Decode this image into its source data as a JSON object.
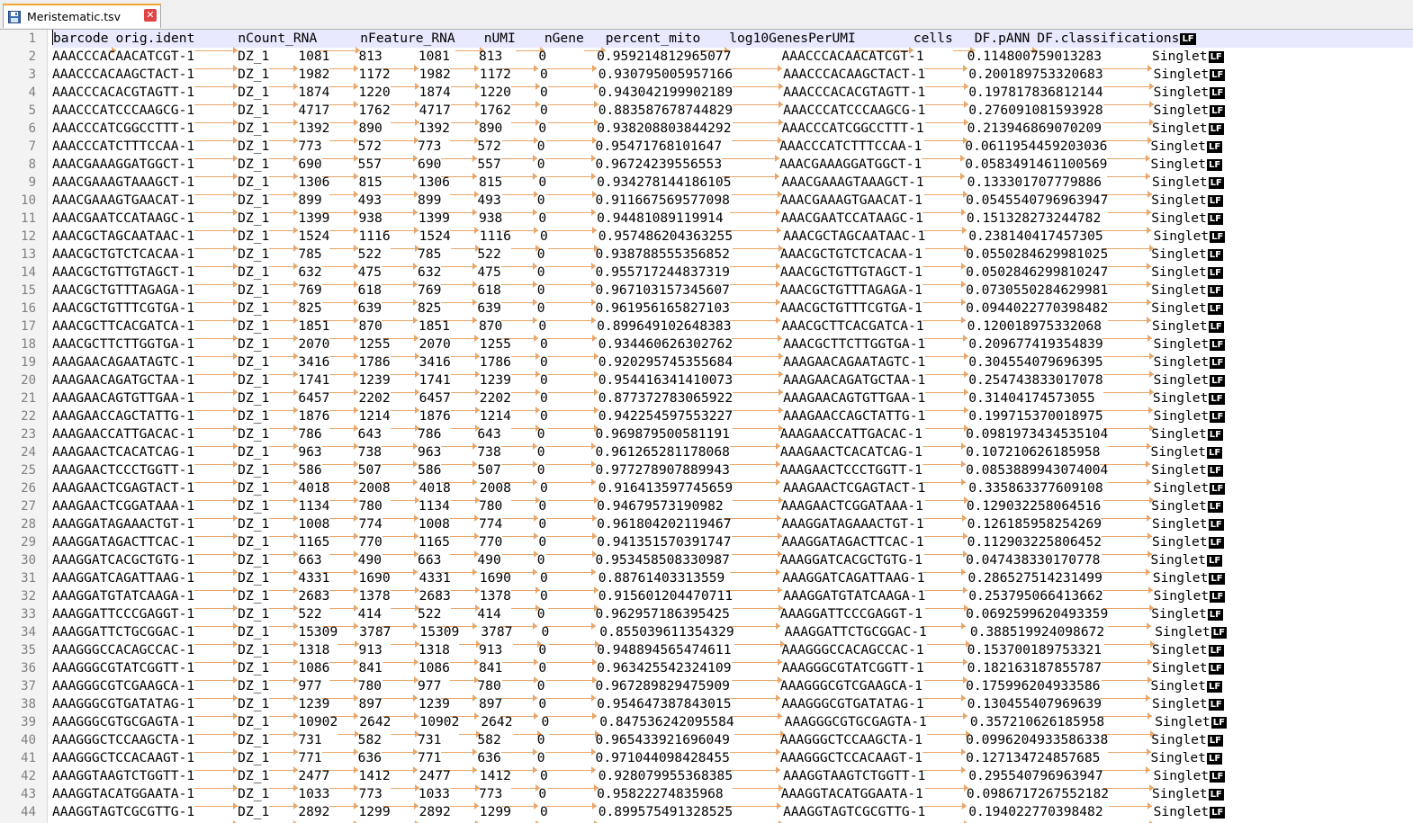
{
  "tab": {
    "title": "Meristematic.tsv",
    "icon": "save-file-icon",
    "close_icon": "close-icon",
    "accent": "#f2a431"
  },
  "editor": {
    "tab_glyph": "→",
    "eol_label": "LF",
    "lines": [
      [
        "barcode",
        "orig.ident",
        "nCount_RNA",
        "nFeature_RNA",
        "nUMI",
        "nGene",
        "percent_mito",
        "log10GenesPerUMI",
        "cells",
        "DF.pANN",
        "DF.classifications"
      ],
      [
        "AAACCCACAACATCGT-1",
        "DZ_1",
        "1081",
        "813",
        "1081",
        "813",
        "0",
        "0.959214812965077",
        "AAACCCACAACATCGT-1",
        "0.114800759013283",
        "Singlet"
      ],
      [
        "AAACCCACAAGCTACT-1",
        "DZ_1",
        "1982",
        "1172",
        "1982",
        "1172",
        "0",
        "0.930795005957166",
        "AAACCCACAAGCTACT-1",
        "0.200189753320683",
        "Singlet"
      ],
      [
        "AAACCCACACGTAGTT-1",
        "DZ_1",
        "1874",
        "1220",
        "1874",
        "1220",
        "0",
        "0.943042199902189",
        "AAACCCACACGTAGTT-1",
        "0.197817836812144",
        "Singlet"
      ],
      [
        "AAACCCATCCCAAGCG-1",
        "DZ_1",
        "4717",
        "1762",
        "4717",
        "1762",
        "0",
        "0.883587678744829",
        "AAACCCATCCCAAGCG-1",
        "0.276091081593928",
        "Singlet"
      ],
      [
        "AAACCCATCGGCCTTT-1",
        "DZ_1",
        "1392",
        "890",
        "1392",
        "890",
        "0",
        "0.938208803844292",
        "AAACCCATCGGCCTTT-1",
        "0.213946869070209",
        "Singlet"
      ],
      [
        "AAACCCATCTTTCCAA-1",
        "DZ_1",
        "773",
        "572",
        "773",
        "572",
        "0",
        "0.95471768101647",
        "AAACCCATCTTTCCAA-1",
        "0.0611954459203036",
        "Singlet"
      ],
      [
        "AAACGAAAGGATGGCT-1",
        "DZ_1",
        "690",
        "557",
        "690",
        "557",
        "0",
        "0.96724239556553",
        "AAACGAAAGGATGGCT-1",
        "0.0583491461100569",
        "Singlet"
      ],
      [
        "AAACGAAAGTAAAGCT-1",
        "DZ_1",
        "1306",
        "815",
        "1306",
        "815",
        "0",
        "0.934278144186105",
        "AAACGAAAGTAAAGCT-1",
        "0.133301707779886",
        "Singlet"
      ],
      [
        "AAACGAAAGTGAACAT-1",
        "DZ_1",
        "899",
        "493",
        "899",
        "493",
        "0",
        "0.911667569577098",
        "AAACGAAAGTGAACAT-1",
        "0.0545540796963947",
        "Singlet"
      ],
      [
        "AAACGAATCCATAAGC-1",
        "DZ_1",
        "1399",
        "938",
        "1399",
        "938",
        "0",
        "0.94481089119914",
        "AAACGAATCCATAAGC-1",
        "0.151328273244782",
        "Singlet"
      ],
      [
        "AAACGCTAGCAATAAC-1",
        "DZ_1",
        "1524",
        "1116",
        "1524",
        "1116",
        "0",
        "0.957486204363255",
        "AAACGCTAGCAATAAC-1",
        "0.238140417457305",
        "Singlet"
      ],
      [
        "AAACGCTGTCTCACAA-1",
        "DZ_1",
        "785",
        "522",
        "785",
        "522",
        "0",
        "0.938788555356852",
        "AAACGCTGTCTCACAA-1",
        "0.0550284629981025",
        "Singlet"
      ],
      [
        "AAACGCTGTTGTAGCT-1",
        "DZ_1",
        "632",
        "475",
        "632",
        "475",
        "0",
        "0.955717244837319",
        "AAACGCTGTTGTAGCT-1",
        "0.0502846299810247",
        "Singlet"
      ],
      [
        "AAACGCTGTTTAGAGA-1",
        "DZ_1",
        "769",
        "618",
        "769",
        "618",
        "0",
        "0.967103157345607",
        "AAACGCTGTTTAGAGA-1",
        "0.0730550284629981",
        "Singlet"
      ],
      [
        "AAACGCTGTTTCGTGA-1",
        "DZ_1",
        "825",
        "639",
        "825",
        "639",
        "0",
        "0.961956165827103",
        "AAACGCTGTTTCGTGA-1",
        "0.0944022770398482",
        "Singlet"
      ],
      [
        "AAACGCTTCACGATCA-1",
        "DZ_1",
        "1851",
        "870",
        "1851",
        "870",
        "0",
        "0.899649102648383",
        "AAACGCTTCACGATCA-1",
        "0.120018975332068",
        "Singlet"
      ],
      [
        "AAACGCTTCTTGGTGA-1",
        "DZ_1",
        "2070",
        "1255",
        "2070",
        "1255",
        "0",
        "0.934460626302762",
        "AAACGCTTCTTGGTGA-1",
        "0.209677419354839",
        "Singlet"
      ],
      [
        "AAAGAACAGAATAGTC-1",
        "DZ_1",
        "3416",
        "1786",
        "3416",
        "1786",
        "0",
        "0.920295745355684",
        "AAAGAACAGAATAGTC-1",
        "0.304554079696395",
        "Singlet"
      ],
      [
        "AAAGAACAGATGCTAA-1",
        "DZ_1",
        "1741",
        "1239",
        "1741",
        "1239",
        "0",
        "0.954416341410073",
        "AAAGAACAGATGCTAA-1",
        "0.254743833017078",
        "Singlet"
      ],
      [
        "AAAGAACAGTGTTGAA-1",
        "DZ_1",
        "6457",
        "2202",
        "6457",
        "2202",
        "0",
        "0.877372783065922",
        "AAAGAACAGTGTTGAA-1",
        "0.31404174573055",
        "Singlet"
      ],
      [
        "AAAGAACCAGCTATTG-1",
        "DZ_1",
        "1876",
        "1214",
        "1876",
        "1214",
        "0",
        "0.942254597553227",
        "AAAGAACCAGCTATTG-1",
        "0.199715370018975",
        "Singlet"
      ],
      [
        "AAAGAACCATTGACAC-1",
        "DZ_1",
        "786",
        "643",
        "786",
        "643",
        "0",
        "0.969879500581191",
        "AAAGAACCATTGACAC-1",
        "0.0981973434535104",
        "Singlet"
      ],
      [
        "AAAGAACTCACATCAG-1",
        "DZ_1",
        "963",
        "738",
        "963",
        "738",
        "0",
        "0.961265281178068",
        "AAAGAACTCACATCAG-1",
        "0.107210626185958",
        "Singlet"
      ],
      [
        "AAAGAACTCCCTGGTT-1",
        "DZ_1",
        "586",
        "507",
        "586",
        "507",
        "0",
        "0.977278907889943",
        "AAAGAACTCCCTGGTT-1",
        "0.0853889943074004",
        "Singlet"
      ],
      [
        "AAAGAACTCGAGTACT-1",
        "DZ_1",
        "4018",
        "2008",
        "4018",
        "2008",
        "0",
        "0.916413597745659",
        "AAAGAACTCGAGTACT-1",
        "0.335863377609108",
        "Singlet"
      ],
      [
        "AAAGAACTCGGATAAA-1",
        "DZ_1",
        "1134",
        "780",
        "1134",
        "780",
        "0",
        "0.94679573190982",
        "AAAGAACTCGGATAAA-1",
        "0.129032258064516",
        "Singlet"
      ],
      [
        "AAAGGATAGAAACTGT-1",
        "DZ_1",
        "1008",
        "774",
        "1008",
        "774",
        "0",
        "0.961804202119467",
        "AAAGGATAGAAACTGT-1",
        "0.126185958254269",
        "Singlet"
      ],
      [
        "AAAGGATAGACTTCAC-1",
        "DZ_1",
        "1165",
        "770",
        "1165",
        "770",
        "0",
        "0.941351570391747",
        "AAAGGATAGACTTCAC-1",
        "0.112903225806452",
        "Singlet"
      ],
      [
        "AAAGGATCACGCTGTG-1",
        "DZ_1",
        "663",
        "490",
        "663",
        "490",
        "0",
        "0.953458508330987",
        "AAAGGATCACGCTGTG-1",
        "0.047438330170778",
        "Singlet"
      ],
      [
        "AAAGGATCAGATTAAG-1",
        "DZ_1",
        "4331",
        "1690",
        "4331",
        "1690",
        "0",
        "0.88761403313559",
        "AAAGGATCAGATTAAG-1",
        "0.286527514231499",
        "Singlet"
      ],
      [
        "AAAGGATGTATCAAGA-1",
        "DZ_1",
        "2683",
        "1378",
        "2683",
        "1378",
        "0",
        "0.915601204470711",
        "AAAGGATGTATCAAGA-1",
        "0.253795066413662",
        "Singlet"
      ],
      [
        "AAAGGATTCCCGAGGT-1",
        "DZ_1",
        "522",
        "414",
        "522",
        "414",
        "0",
        "0.962957186395425",
        "AAAGGATTCCCGAGGT-1",
        "0.0692599620493359",
        "Singlet"
      ],
      [
        "AAAGGATTCTGCGGAC-1",
        "DZ_1",
        "15309",
        "3787",
        "15309",
        "3787",
        "0",
        "0.855039611354329",
        "AAAGGATTCTGCGGAC-1",
        "0.388519924098672",
        "Singlet"
      ],
      [
        "AAAGGGCCACAGCCAC-1",
        "DZ_1",
        "1318",
        "913",
        "1318",
        "913",
        "0",
        "0.948894565474611",
        "AAAGGGCCACAGCCAC-1",
        "0.153700189753321",
        "Singlet"
      ],
      [
        "AAAGGGCGTATCGGTT-1",
        "DZ_1",
        "1086",
        "841",
        "1086",
        "841",
        "0",
        "0.963425542324109",
        "AAAGGGCGTATCGGTT-1",
        "0.182163187855787",
        "Singlet"
      ],
      [
        "AAAGGGCGTCGAAGCA-1",
        "DZ_1",
        "977",
        "780",
        "977",
        "780",
        "0",
        "0.967289829475909",
        "AAAGGGCGTCGAAGCA-1",
        "0.175996204933586",
        "Singlet"
      ],
      [
        "AAAGGGCGTGATATAG-1",
        "DZ_1",
        "1239",
        "897",
        "1239",
        "897",
        "0",
        "0.954647387843015",
        "AAAGGGCGTGATATAG-1",
        "0.130455407969639",
        "Singlet"
      ],
      [
        "AAAGGGCGTGCGAGTA-1",
        "DZ_1",
        "10902",
        "2642",
        "10902",
        "2642",
        "0",
        "0.847536242095584",
        "AAAGGGCGTGCGAGTA-1",
        "0.357210626185958",
        "Singlet"
      ],
      [
        "AAAGGGCTCCAAGCTA-1",
        "DZ_1",
        "731",
        "582",
        "731",
        "582",
        "0",
        "0.965433921696049",
        "AAAGGGCTCCAAGCTA-1",
        "0.0996204933586338",
        "Singlet"
      ],
      [
        "AAAGGGCTCCACAAGT-1",
        "DZ_1",
        "771",
        "636",
        "771",
        "636",
        "0",
        "0.971044098428455",
        "AAAGGGCTCCACAAGT-1",
        "0.127134724857685",
        "Singlet"
      ],
      [
        "AAAGGTAAGTCTGGTT-1",
        "DZ_1",
        "2477",
        "1412",
        "2477",
        "1412",
        "0",
        "0.928079955368385",
        "AAAGGTAAGTCTGGTT-1",
        "0.295540796963947",
        "Singlet"
      ],
      [
        "AAAGGTACATGGAATA-1",
        "DZ_1",
        "1033",
        "773",
        "1033",
        "773",
        "0",
        "0.95822274835968",
        "AAAGGTACATGGAATA-1",
        "0.0986717267552182",
        "Singlet"
      ],
      [
        "AAAGGTAGTCGCGTTG-1",
        "DZ_1",
        "2892",
        "1299",
        "2892",
        "1299",
        "0",
        "0.899575491328525",
        "AAAGGTAGTCGCGTTG-1",
        "0.194022770398482",
        "Singlet"
      ]
    ]
  }
}
